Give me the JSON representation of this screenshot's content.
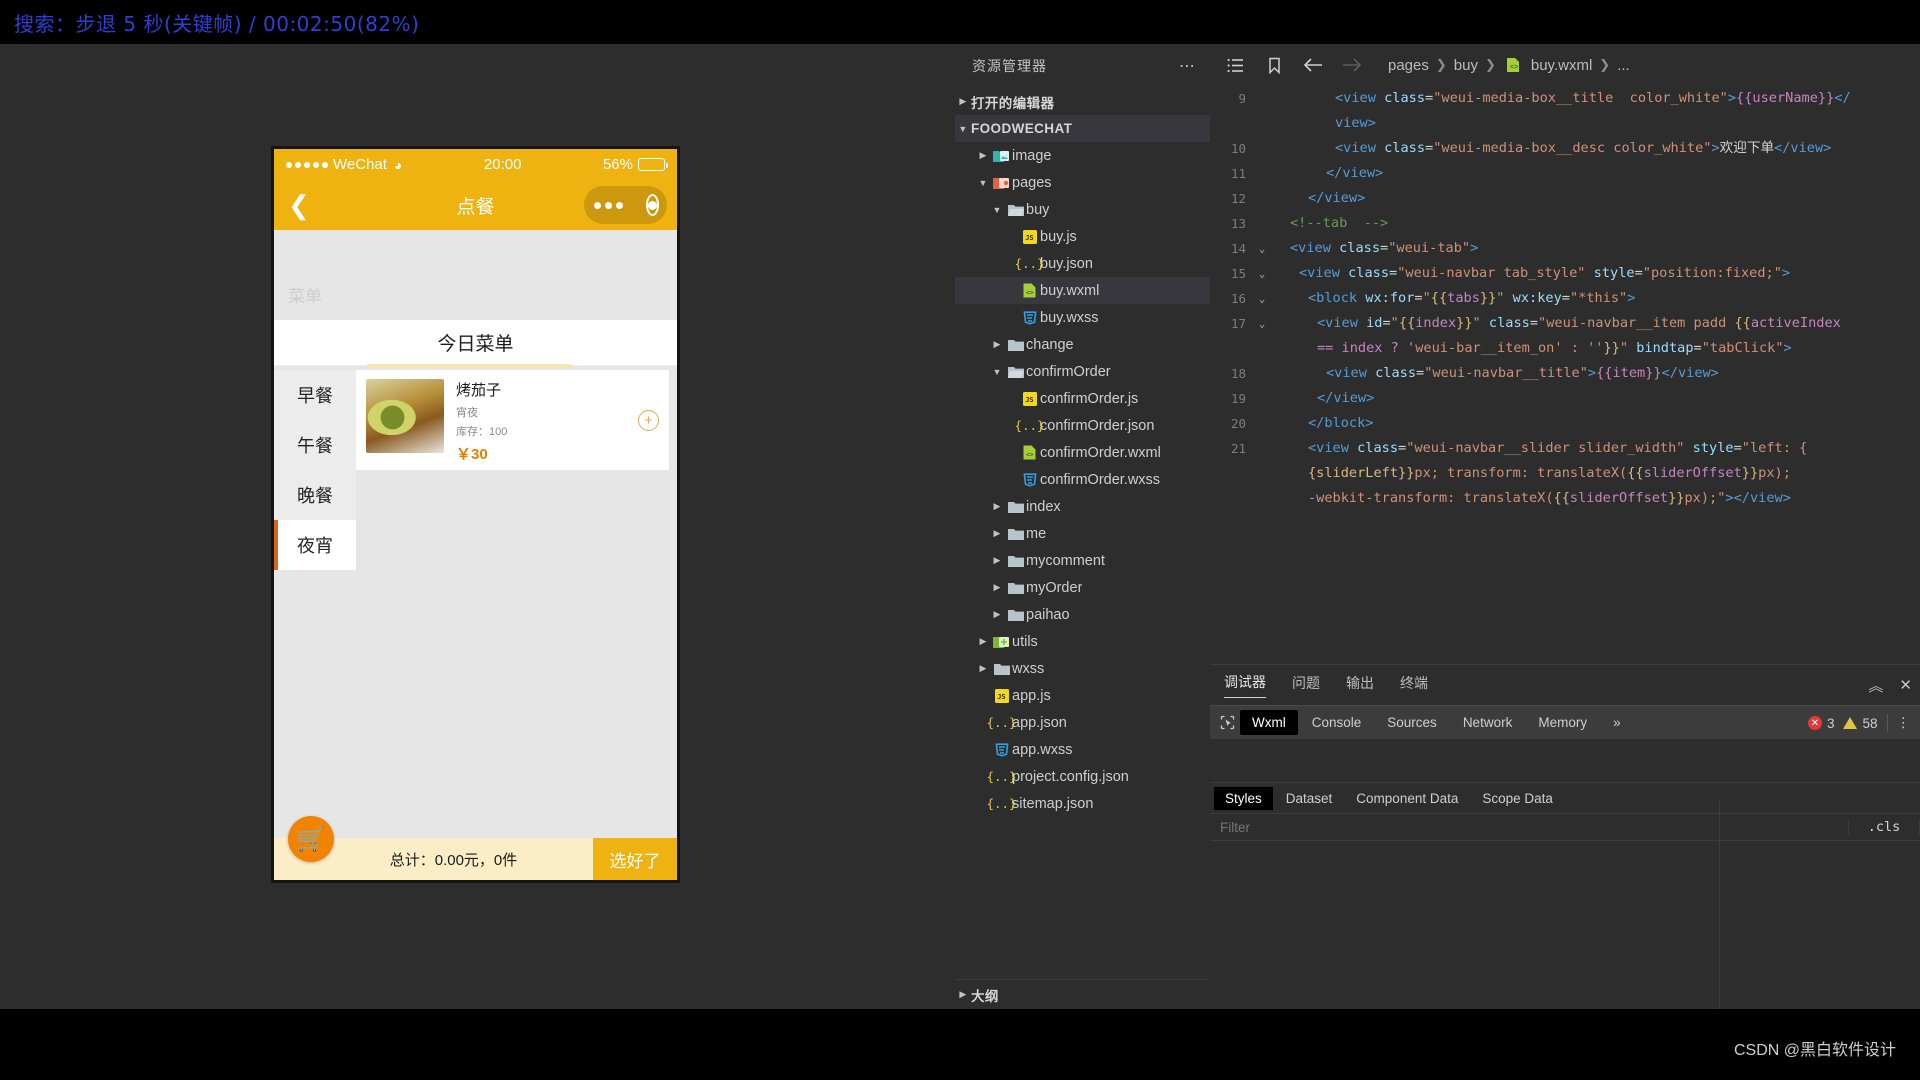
{
  "topbar": {
    "text": "搜索：步退 5 秒(关键帧) / 00:02:50(82%)"
  },
  "simulator": {
    "status": {
      "carrier": "WeChat",
      "time": "20:00",
      "battery_percent": "56%",
      "battery_level": 56
    },
    "navbar": {
      "back_icon": "chevron-left-icon",
      "title": "点餐"
    },
    "capsule": {
      "more_icon": "ellipsis-icon",
      "target_icon": "target-icon"
    },
    "ghost_text": "菜单",
    "menu_title": "今日菜单",
    "tabs": [
      {
        "label": "早餐",
        "active": false
      },
      {
        "label": "午餐",
        "active": false
      },
      {
        "label": "晚餐",
        "active": false
      },
      {
        "label": "夜宵",
        "active": true
      }
    ],
    "dish": {
      "name": "烤茄子",
      "category": "宵夜",
      "stock_label": "库存：100",
      "price": "￥30",
      "add_icon": "plus-circle-icon"
    },
    "footer": {
      "cart_icon": "shopping-cart-icon",
      "total": "总计：0.00元，0件",
      "confirm_label": "选好了"
    }
  },
  "explorer": {
    "title": "资源管理器",
    "more_icon": "ellipsis-icon",
    "open_editors": "打开的编辑器",
    "project": "FOODWECHAT",
    "outline": "大纲",
    "tree": [
      {
        "label": "image",
        "indent": 1,
        "type": "folder-image",
        "arrow": "right",
        "selected": false
      },
      {
        "label": "pages",
        "indent": 1,
        "type": "folder-pages",
        "arrow": "down",
        "selected": false
      },
      {
        "label": "buy",
        "indent": 2,
        "type": "folder-open",
        "arrow": "down",
        "selected": false
      },
      {
        "label": "buy.js",
        "indent": 3,
        "type": "js",
        "arrow": "none",
        "selected": false
      },
      {
        "label": "buy.json",
        "indent": 3,
        "type": "json",
        "arrow": "none",
        "selected": false
      },
      {
        "label": "buy.wxml",
        "indent": 3,
        "type": "wxml",
        "arrow": "none",
        "selected": true
      },
      {
        "label": "buy.wxss",
        "indent": 3,
        "type": "wxss",
        "arrow": "none",
        "selected": false
      },
      {
        "label": "change",
        "indent": 2,
        "type": "folder",
        "arrow": "right",
        "selected": false
      },
      {
        "label": "confirmOrder",
        "indent": 2,
        "type": "folder-open",
        "arrow": "down",
        "selected": false
      },
      {
        "label": "confirmOrder.js",
        "indent": 3,
        "type": "js",
        "arrow": "none",
        "selected": false
      },
      {
        "label": "confirmOrder.json",
        "indent": 3,
        "type": "json",
        "arrow": "none",
        "selected": false
      },
      {
        "label": "confirmOrder.wxml",
        "indent": 3,
        "type": "wxml",
        "arrow": "none",
        "selected": false
      },
      {
        "label": "confirmOrder.wxss",
        "indent": 3,
        "type": "wxss",
        "arrow": "none",
        "selected": false
      },
      {
        "label": "index",
        "indent": 2,
        "type": "folder",
        "arrow": "right",
        "selected": false
      },
      {
        "label": "me",
        "indent": 2,
        "type": "folder",
        "arrow": "right",
        "selected": false
      },
      {
        "label": "mycomment",
        "indent": 2,
        "type": "folder",
        "arrow": "right",
        "selected": false
      },
      {
        "label": "myOrder",
        "indent": 2,
        "type": "folder",
        "arrow": "right",
        "selected": false
      },
      {
        "label": "paihao",
        "indent": 2,
        "type": "folder",
        "arrow": "right",
        "selected": false
      },
      {
        "label": "utils",
        "indent": 1,
        "type": "folder-utils",
        "arrow": "right",
        "selected": false
      },
      {
        "label": "wxss",
        "indent": 1,
        "type": "folder",
        "arrow": "right",
        "selected": false
      },
      {
        "label": "app.js",
        "indent": 1,
        "type": "js",
        "arrow": "none",
        "selected": false
      },
      {
        "label": "app.json",
        "indent": 1,
        "type": "json",
        "arrow": "none",
        "selected": false
      },
      {
        "label": "app.wxss",
        "indent": 1,
        "type": "wxss",
        "arrow": "none",
        "selected": false
      },
      {
        "label": "project.config.json",
        "indent": 1,
        "type": "json",
        "arrow": "none",
        "selected": false
      },
      {
        "label": "sitemap.json",
        "indent": 1,
        "type": "json",
        "arrow": "none",
        "selected": false
      }
    ]
  },
  "editor": {
    "toolbar": {
      "outline_icon": "list-icon",
      "bookmark_icon": "bookmark-icon",
      "back_icon": "arrow-left-icon",
      "forward_icon": "arrow-right-icon"
    },
    "breadcrumb": [
      "pages",
      "buy",
      "buy.wxml",
      "..."
    ],
    "lines": [
      {
        "num": "9",
        "fold": "",
        "indent": 7,
        "segs": [
          {
            "t": "tag",
            "v": "<view "
          },
          {
            "t": "attr",
            "v": "class"
          },
          {
            "t": "pun",
            "v": "="
          },
          {
            "t": "str",
            "v": "\"weui-media-box__title  color_white\""
          },
          {
            "t": "tag",
            "v": ">"
          },
          {
            "t": "mus",
            "v": "{{userName}}"
          },
          {
            "t": "tag",
            "v": "</"
          }
        ]
      },
      {
        "num": "",
        "fold": "",
        "indent": 7,
        "segs": [
          {
            "t": "tag",
            "v": "view>"
          }
        ]
      },
      {
        "num": "10",
        "fold": "",
        "indent": 7,
        "segs": [
          {
            "t": "tag",
            "v": "<view "
          },
          {
            "t": "attr",
            "v": "class"
          },
          {
            "t": "pun",
            "v": "="
          },
          {
            "t": "str",
            "v": "\"weui-media-box__desc color_white\""
          },
          {
            "t": "tag",
            "v": ">"
          },
          {
            "t": "pun",
            "v": "欢迎下单"
          },
          {
            "t": "tag",
            "v": "</view>"
          }
        ]
      },
      {
        "num": "11",
        "fold": "",
        "indent": 6,
        "segs": [
          {
            "t": "tag",
            "v": "</view>"
          }
        ]
      },
      {
        "num": "12",
        "fold": "",
        "indent": 4,
        "segs": [
          {
            "t": "tag",
            "v": "</view>"
          }
        ]
      },
      {
        "num": "13",
        "fold": "",
        "indent": 2,
        "segs": [
          {
            "t": "cmt",
            "v": "<!--tab  -->"
          }
        ]
      },
      {
        "num": "14",
        "fold": "v",
        "indent": 2,
        "segs": [
          {
            "t": "tag",
            "v": "<view "
          },
          {
            "t": "attr",
            "v": "class"
          },
          {
            "t": "pun",
            "v": "="
          },
          {
            "t": "str",
            "v": "\"weui-tab\""
          },
          {
            "t": "tag",
            "v": ">"
          }
        ]
      },
      {
        "num": "15",
        "fold": "v",
        "indent": 3,
        "segs": [
          {
            "t": "tag",
            "v": "<view "
          },
          {
            "t": "attr",
            "v": "class"
          },
          {
            "t": "pun",
            "v": "="
          },
          {
            "t": "str",
            "v": "\"weui-navbar tab_style\""
          },
          {
            "t": "pun",
            "v": " "
          },
          {
            "t": "attr",
            "v": "style"
          },
          {
            "t": "pun",
            "v": "="
          },
          {
            "t": "str",
            "v": "\"position:fixed;\""
          },
          {
            "t": "tag",
            "v": ">"
          }
        ]
      },
      {
        "num": "16",
        "fold": "v",
        "indent": 4,
        "segs": [
          {
            "t": "tag",
            "v": "<block "
          },
          {
            "t": "attr",
            "v": "wx:for"
          },
          {
            "t": "pun",
            "v": "="
          },
          {
            "t": "str",
            "v": "\""
          },
          {
            "t": "br",
            "v": "{{"
          },
          {
            "t": "mus",
            "v": "tabs"
          },
          {
            "t": "br",
            "v": "}}"
          },
          {
            "t": "str",
            "v": "\""
          },
          {
            "t": "pun",
            "v": " "
          },
          {
            "t": "attr",
            "v": "wx:key"
          },
          {
            "t": "pun",
            "v": "="
          },
          {
            "t": "str",
            "v": "\"*this\""
          },
          {
            "t": "tag",
            "v": ">"
          }
        ]
      },
      {
        "num": "17",
        "fold": "v",
        "indent": 5,
        "segs": [
          {
            "t": "tag",
            "v": "<view "
          },
          {
            "t": "attr",
            "v": "id"
          },
          {
            "t": "pun",
            "v": "="
          },
          {
            "t": "str",
            "v": "\""
          },
          {
            "t": "br",
            "v": "{{"
          },
          {
            "t": "mus",
            "v": "index"
          },
          {
            "t": "br",
            "v": "}}"
          },
          {
            "t": "str",
            "v": "\""
          },
          {
            "t": "pun",
            "v": " "
          },
          {
            "t": "attr",
            "v": "class"
          },
          {
            "t": "pun",
            "v": "="
          },
          {
            "t": "str",
            "v": "\"weui-navbar__item padd "
          },
          {
            "t": "br",
            "v": "{{"
          },
          {
            "t": "mus",
            "v": "activeIndex"
          }
        ]
      },
      {
        "num": "",
        "fold": "",
        "indent": 5,
        "segs": [
          {
            "t": "mus",
            "v": "== index ? "
          },
          {
            "t": "str",
            "v": "'weui-bar__item_on'"
          },
          {
            "t": "mus",
            "v": " : "
          },
          {
            "t": "str",
            "v": "''"
          },
          {
            "t": "br",
            "v": "}}"
          },
          {
            "t": "str",
            "v": "\""
          },
          {
            "t": "pun",
            "v": " "
          },
          {
            "t": "attr",
            "v": "bindtap"
          },
          {
            "t": "pun",
            "v": "="
          },
          {
            "t": "str",
            "v": "\"tabClick\""
          },
          {
            "t": "tag",
            "v": ">"
          }
        ]
      },
      {
        "num": "18",
        "fold": "",
        "indent": 6,
        "segs": [
          {
            "t": "tag",
            "v": "<view "
          },
          {
            "t": "attr",
            "v": "class"
          },
          {
            "t": "pun",
            "v": "="
          },
          {
            "t": "str",
            "v": "\"weui-navbar__title\""
          },
          {
            "t": "tag",
            "v": ">"
          },
          {
            "t": "mus",
            "v": "{{item}}"
          },
          {
            "t": "tag",
            "v": "</view>"
          }
        ]
      },
      {
        "num": "19",
        "fold": "",
        "indent": 5,
        "segs": [
          {
            "t": "tag",
            "v": "</view>"
          }
        ]
      },
      {
        "num": "20",
        "fold": "",
        "indent": 4,
        "segs": [
          {
            "t": "tag",
            "v": "</block>"
          }
        ]
      },
      {
        "num": "21",
        "fold": "",
        "indent": 4,
        "segs": [
          {
            "t": "tag",
            "v": "<view "
          },
          {
            "t": "attr",
            "v": "class"
          },
          {
            "t": "pun",
            "v": "="
          },
          {
            "t": "str",
            "v": "\"weui-navbar__slider slider_width\""
          },
          {
            "t": "pun",
            "v": " "
          },
          {
            "t": "attr",
            "v": "style"
          },
          {
            "t": "pun",
            "v": "="
          },
          {
            "t": "str",
            "v": "\"left: {"
          }
        ]
      },
      {
        "num": "",
        "fold": "",
        "indent": 4,
        "segs": [
          {
            "t": "br",
            "v": "{sliderLeft}}"
          },
          {
            "t": "str",
            "v": "px; transform: translateX("
          },
          {
            "t": "br",
            "v": "{{"
          },
          {
            "t": "mus",
            "v": "sliderOffset"
          },
          {
            "t": "br",
            "v": "}}"
          },
          {
            "t": "str",
            "v": "px);"
          }
        ]
      },
      {
        "num": "",
        "fold": "",
        "indent": 4,
        "segs": [
          {
            "t": "str",
            "v": "-webkit-transform: translateX("
          },
          {
            "t": "br",
            "v": "{{"
          },
          {
            "t": "mus",
            "v": "sliderOffset"
          },
          {
            "t": "br",
            "v": "}}"
          },
          {
            "t": "str",
            "v": "px);\""
          },
          {
            "t": "tag",
            "v": "></view>"
          }
        ]
      }
    ]
  },
  "debugger": {
    "panel_tabs": [
      {
        "label": "调试器",
        "active": true
      },
      {
        "label": "问题",
        "active": false
      },
      {
        "label": "输出",
        "active": false
      },
      {
        "label": "终端",
        "active": false
      }
    ],
    "collapse_icon": "chevron-up-icon",
    "close_icon": "close-icon",
    "inspect_icon": "cursor-select-icon",
    "devtool_tabs": [
      {
        "label": "Wxml",
        "active": true
      },
      {
        "label": "Console",
        "active": false
      },
      {
        "label": "Sources",
        "active": false
      },
      {
        "label": "Network",
        "active": false
      },
      {
        "label": "Memory",
        "active": false
      }
    ],
    "overflow_icon": "chevron-double-right-icon",
    "error_count": "3",
    "warning_count": "58",
    "kebab_icon": "more-vertical-icon",
    "sub_tabs": [
      {
        "label": "Styles",
        "active": true
      },
      {
        "label": "Dataset",
        "active": false
      },
      {
        "label": "Component Data",
        "active": false
      },
      {
        "label": "Scope Data",
        "active": false
      }
    ],
    "filter_placeholder": "Filter",
    "cls_label": ".cls"
  },
  "watermark": {
    "text": "CSDN @黑白软件设计"
  },
  "colors": {
    "accent_yellow": "#eeb211",
    "accent_orange": "#f08300",
    "ide_bg": "#2d2d2d",
    "selection": "#37373d"
  }
}
